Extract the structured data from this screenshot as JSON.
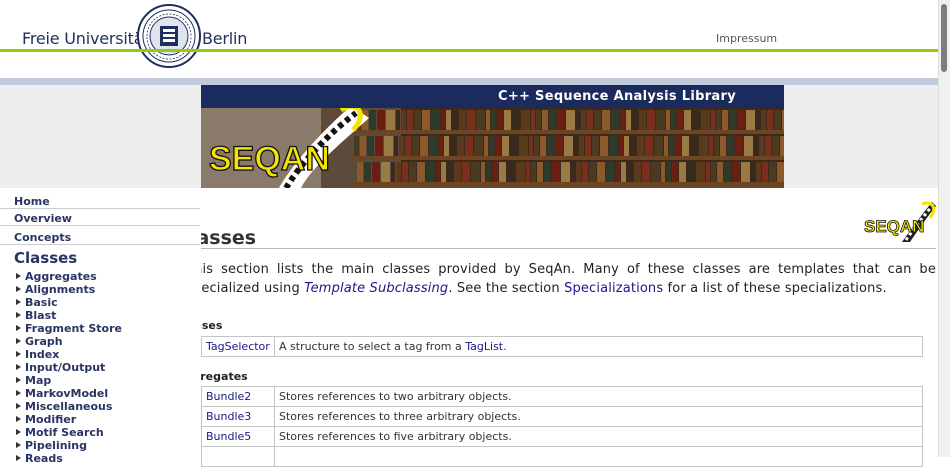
{
  "header": {
    "university_left": "Freie Universität",
    "university_right": "Berlin",
    "impressum": "Impressum"
  },
  "banner": {
    "title": "C++ Sequence Analysis Library",
    "logo_text": "SEQAN"
  },
  "sidebar": {
    "nav": [
      "Home",
      "Overview",
      "Concepts"
    ],
    "classes_heading": "Classes",
    "categories": [
      "Aggregates",
      "Alignments",
      "Basic",
      "Blast",
      "Fragment Store",
      "Graph",
      "Index",
      "Input/Output",
      "Map",
      "MarkovModel",
      "Miscellaneous",
      "Modifier",
      "Motif Search",
      "Pipelining",
      "Reads"
    ]
  },
  "main": {
    "heading": "Classes",
    "intro_before": "This section lists the main classes provided by SeqAn. Many of these classes are templates that can be specialized using ",
    "intro_link1": "Template Subclassing",
    "intro_middle": ". See the section ",
    "intro_link2": "Specializations",
    "intro_after": " for a list of these specializations.",
    "sections": [
      {
        "title": "Classes",
        "rows": [
          {
            "name": "TagSelector",
            "desc": "A structure to select a tag from a ",
            "desc_link": "TagList",
            "desc_after": "."
          }
        ]
      },
      {
        "title": "Aggregates",
        "rows": [
          {
            "name": "Bundle2",
            "desc": "Stores references to two arbitrary objects."
          },
          {
            "name": "Bundle3",
            "desc": "Stores references to three arbitrary objects."
          },
          {
            "name": "Bundle5",
            "desc": "Stores references to five arbitrary objects."
          }
        ]
      }
    ]
  },
  "colors": {
    "navy": "#1b2b5e",
    "green_rule": "#99cc00",
    "link": "#1a1a8a",
    "logo_yellow": "#f5e400"
  }
}
